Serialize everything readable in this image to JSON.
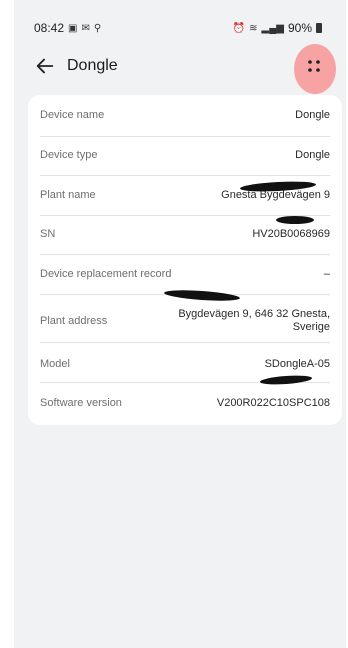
{
  "status_bar": {
    "time": "08:42",
    "left_icons": [
      "image-icon",
      "mail-icon",
      "location-icon"
    ],
    "right_icons": [
      "alarm-icon",
      "wifi-icon",
      "signal-icon"
    ],
    "battery": "90%"
  },
  "header": {
    "title": "Dongle"
  },
  "device_info": {
    "device_name": {
      "label": "Device name",
      "value": "Dongle"
    },
    "device_type": {
      "label": "Device type",
      "value": "Dongle"
    },
    "plant_name": {
      "label": "Plant name",
      "value": "Gnesta Bygdevägen 9"
    },
    "sn": {
      "label": "SN",
      "value": "HV20B0068969"
    },
    "replacement": {
      "label": "Device replacement record",
      "value": "–"
    },
    "plant_address": {
      "label": "Plant address",
      "value_line1": "Bygdevägen 9, 646 32 Gnesta,",
      "value_line2": "Sverige"
    },
    "model": {
      "label": "Model",
      "value": "SDongleA-05"
    },
    "software_version": {
      "label": "Software version",
      "value": "V200R022C10SPC108"
    }
  },
  "colors": {
    "background": "#f1f2f4",
    "card": "#ffffff",
    "highlight": "#f7a3a3"
  }
}
